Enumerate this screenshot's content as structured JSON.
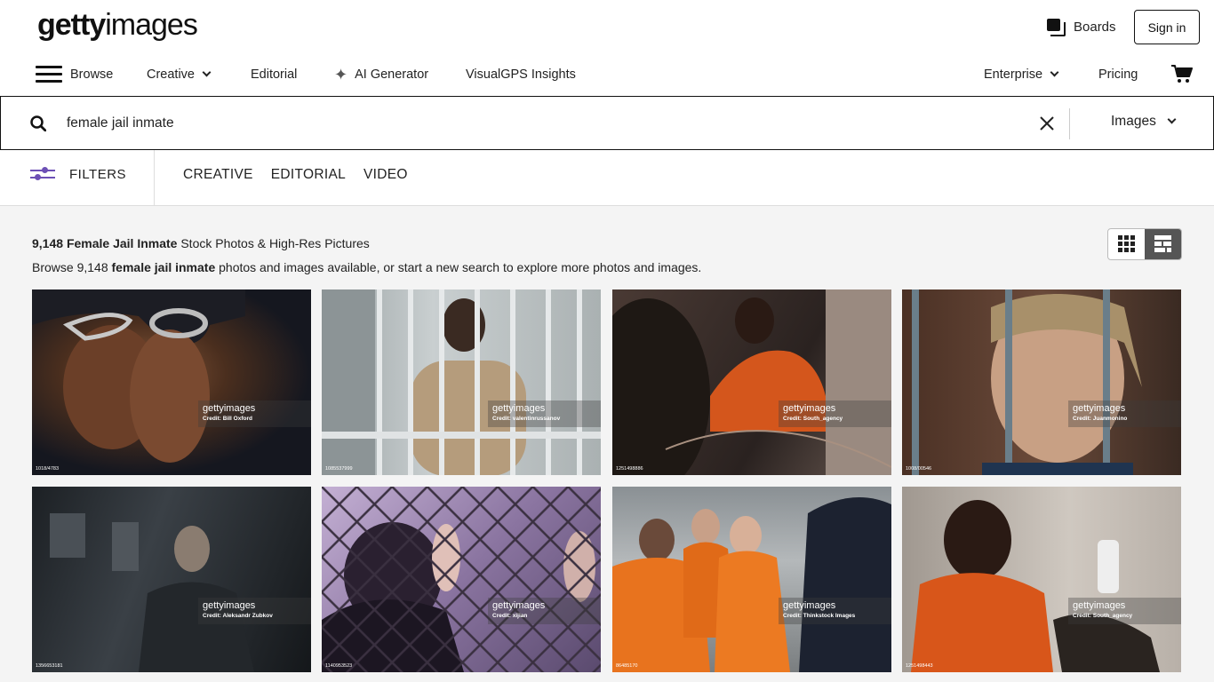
{
  "header": {
    "logo_bold": "getty",
    "logo_light": "images",
    "boards_label": "Boards",
    "signin_label": "Sign in"
  },
  "nav": {
    "browse": "Browse",
    "creative": "Creative",
    "editorial": "Editorial",
    "ai_generator": "AI Generator",
    "visualgps": "VisualGPS Insights",
    "enterprise": "Enterprise",
    "pricing": "Pricing"
  },
  "search": {
    "query": "female jail inmate",
    "type": "Images"
  },
  "filters": {
    "label": "FILTERS",
    "tabs": [
      "CREATIVE",
      "EDITORIAL",
      "VIDEO"
    ]
  },
  "results": {
    "count": "9,148",
    "title_term": "Female Jail Inmate",
    "title_suffix": "Stock Photos & High-Res Pictures",
    "sub_prefix": "Browse",
    "sub_count": "9,148",
    "sub_term": "female jail inmate",
    "sub_suffix": "photos and images available, or start a new search to explore more photos and images."
  },
  "tiles": [
    {
      "brand": "gettyimages",
      "credit": "Credit: Bill Oxford",
      "id": "1018/4783"
    },
    {
      "brand": "gettyimages",
      "credit": "Credit: valentinrussanov",
      "id": "1085537999"
    },
    {
      "brand": "gettyimages",
      "credit": "Credit: South_agency",
      "id": "1251498886"
    },
    {
      "brand": "gettyimages",
      "credit": "Credit: Juanmonino",
      "id": "1008/00546"
    },
    {
      "brand": "gettyimages",
      "credit": "Credit: Aleksandr Zubkov",
      "id": "1356653181"
    },
    {
      "brand": "gettyimages",
      "credit": "Credit: xijian",
      "id": "1140953523"
    },
    {
      "brand": "gettyimages",
      "credit": "Credit: Thinkstock Images",
      "id": "86485170"
    },
    {
      "brand": "gettyimages",
      "credit": "Credit: South_agency",
      "id": "1251498443"
    }
  ],
  "colors": {
    "accent": "#6c4fb5",
    "text": "#1a1a1a",
    "background": "#f4f4f4"
  }
}
